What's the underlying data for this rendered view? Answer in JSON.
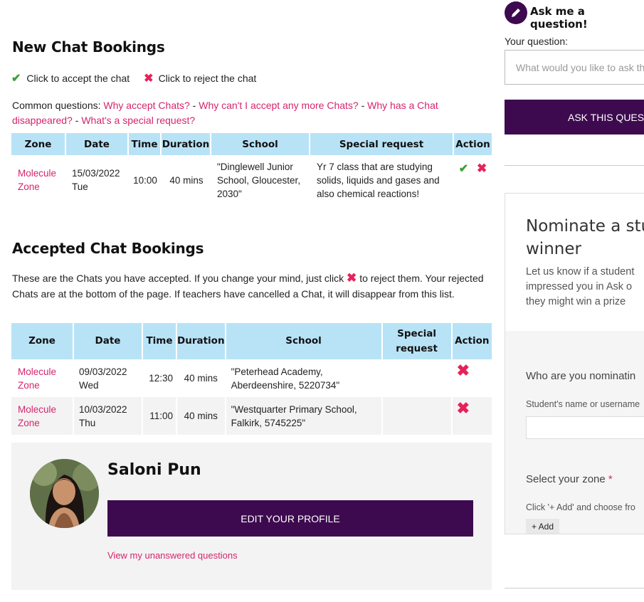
{
  "new_bookings": {
    "title": "New Chat Bookings",
    "legend_accept": "Click to accept the chat",
    "legend_reject": "Click to reject the chat",
    "common_prefix": "Common questions:",
    "faq_links": [
      "Why accept Chats?",
      "Why can't I accept any more Chats?",
      "Why has a Chat disappeared?",
      "What's a special request?"
    ],
    "columns": [
      "Zone",
      "Date",
      "Time",
      "Duration",
      "School",
      "Special request",
      "Action"
    ],
    "rows": [
      {
        "zone": "Molecule Zone",
        "date": "15/03/2022",
        "day": "Tue",
        "time": "10:00",
        "duration": "40 mins",
        "school": "\"Dinglewell Junior School, Gloucester, 2030\"",
        "special_request": "Yr 7 class that are studying solids, liquids and gases and also chemical reactions!"
      }
    ]
  },
  "accepted_bookings": {
    "title": "Accepted Chat Bookings",
    "intro_before": "These are the Chats you have accepted. If you change your mind, just click",
    "intro_after": "to reject them. Your rejected Chats are at the bottom of the page. If teachers have cancelled a Chat, it will disappear from this list.",
    "columns": [
      "Zone",
      "Date",
      "Time",
      "Duration",
      "School",
      "Special request",
      "Action"
    ],
    "rows": [
      {
        "zone": "Molecule Zone",
        "date": "09/03/2022",
        "day": "Wed",
        "time": "12:30",
        "duration": "40 mins",
        "school": "\"Peterhead Academy, Aberdeenshire, 5220734\"",
        "special_request": ""
      },
      {
        "zone": "Molecule Zone",
        "date": "10/03/2022",
        "day": "Thu",
        "time": "11:00",
        "duration": "40 mins",
        "school": "\"Westquarter Primary School, Falkirk, 5745225\"",
        "special_request": ""
      }
    ]
  },
  "profile": {
    "name": "Saloni Pun",
    "edit_label": "EDIT YOUR PROFILE",
    "unanswered_link": "View my unanswered questions"
  },
  "sidebar": {
    "ask_title": "Ask me a question!",
    "question_label": "Your question:",
    "question_placeholder": "What would you like to ask th",
    "ask_button": "ASK THIS QUES",
    "nominate_title_line1": "Nominate a stu",
    "nominate_title_line2": "winner",
    "nominate_desc_line1": "Let us know if a student",
    "nominate_desc_line2": "impressed you in Ask o",
    "nominate_desc_line3": "they might win a prize",
    "who_label": "Who are you nominatin",
    "student_label": "Student's name or username",
    "zone_label": "Select your zone",
    "zone_required": "*",
    "zone_hint": "Click '+ Add' and choose fro",
    "add_button": "+ Add"
  },
  "icons": {
    "accept": "check-icon",
    "reject": "cross-icon",
    "ask": "pencil-icon"
  },
  "colors": {
    "accent_pink": "#d6246e",
    "brand_purple": "#3d0a4f",
    "table_header": "#b8e3f7",
    "accept_green": "#3aa03a",
    "reject_red": "#e5225a"
  }
}
